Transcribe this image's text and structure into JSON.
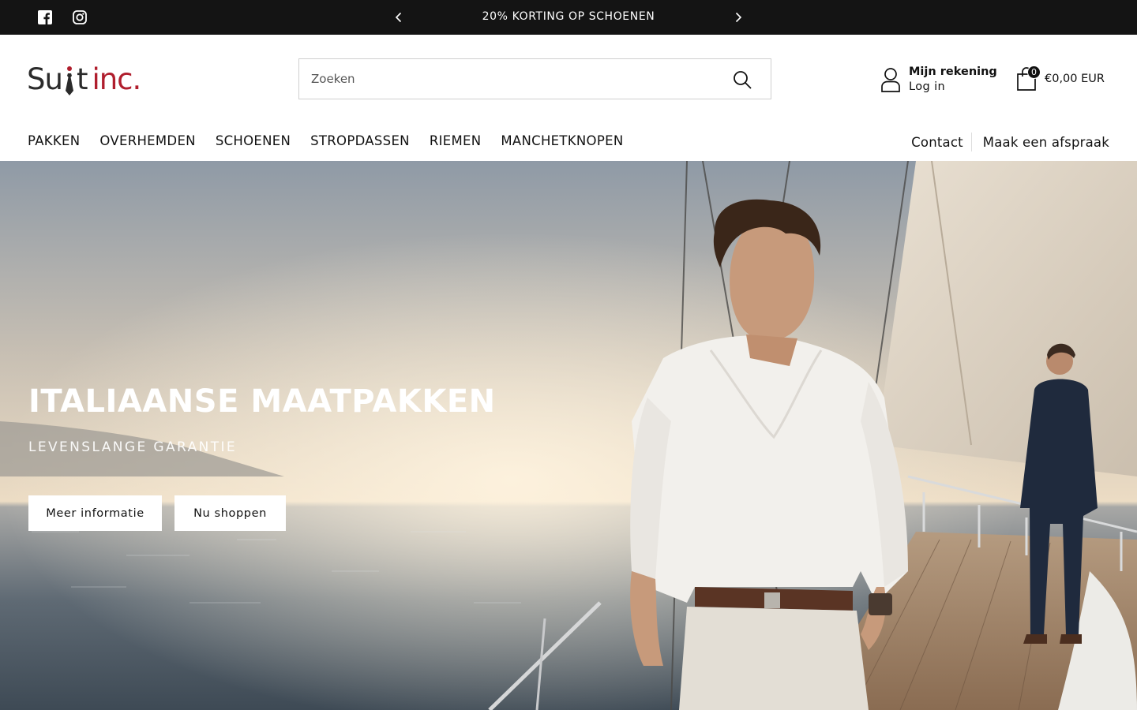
{
  "announcement": {
    "text": "20% KORTING OP SCHOENEN",
    "prev_icon": "chevron-left-icon",
    "next_icon": "chevron-right-icon"
  },
  "social": [
    {
      "name": "facebook",
      "icon": "facebook-icon"
    },
    {
      "name": "instagram",
      "icon": "instagram-icon"
    }
  ],
  "logo": {
    "part1": "Su",
    "part2": "t",
    "part3": "inc.",
    "brand_color": "#b01e2d"
  },
  "search": {
    "placeholder": "Zoeken",
    "icon": "search-icon"
  },
  "account": {
    "title": "Mijn rekening",
    "subtitle": "Log in",
    "icon": "user-icon"
  },
  "cart": {
    "count": "0",
    "total": "€0,00 EUR",
    "icon": "shopping-bag-icon"
  },
  "nav": {
    "items": [
      "PAKKEN",
      "OVERHEMDEN",
      "SCHOENEN",
      "STROPDASSEN",
      "RIEMEN",
      "MANCHETKNOPEN"
    ],
    "right": [
      "Contact",
      "Maak een afspraak"
    ]
  },
  "hero": {
    "title": "ITALIAANSE MAATPAKKEN",
    "subtitle": "LEVENSLANGE GARANTIE",
    "buttons": [
      "Meer informatie",
      "Nu shoppen"
    ]
  },
  "colors": {
    "topbar": "#141414",
    "accent": "#b01e2d",
    "text": "#111111"
  }
}
